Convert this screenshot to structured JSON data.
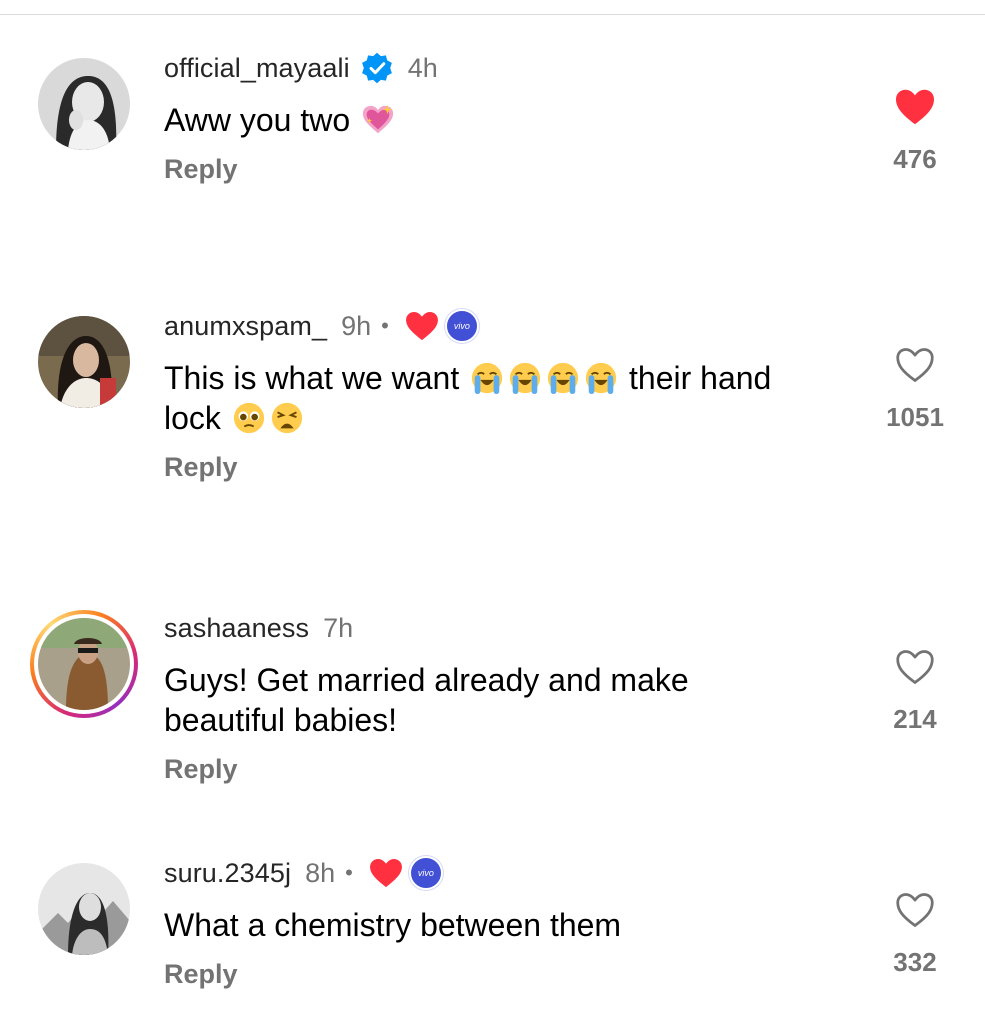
{
  "comments": [
    {
      "username": "official_mayaali",
      "verified": true,
      "time": "4h",
      "text": "Aww you two",
      "text_emojis": [
        "sparkling-heart"
      ],
      "reply_label": "Reply",
      "likes": "476",
      "liked": true
    },
    {
      "username": "anumxspam_",
      "time": "9h",
      "dot": "•",
      "creator_liked": true,
      "badge": "vivo",
      "text_part1": "This is what we want",
      "text_emojis_1": [
        "loudly-crying-face",
        "loudly-crying-face",
        "loudly-crying-face",
        "loudly-crying-face"
      ],
      "text_part2": "their hand",
      "text_part3": "lock",
      "text_emojis_2": [
        "pleading-face",
        "weary-face"
      ],
      "reply_label": "Reply",
      "likes": "1051",
      "liked": false
    },
    {
      "username": "sashaaness",
      "time": "7h",
      "story_ring": true,
      "text_line1": "Guys! Get married already and make",
      "text_line2": "beautiful babies!",
      "reply_label": "Reply",
      "likes": "214",
      "liked": false
    },
    {
      "username": "suru.2345j",
      "time": "8h",
      "dot": "•",
      "creator_liked": true,
      "badge": "vivo",
      "text": "What a chemistry between them",
      "reply_label": "Reply",
      "likes": "332",
      "liked": false
    }
  ],
  "colors": {
    "like_red": "#ff3040",
    "verified_blue": "#0095f6",
    "muted_gray": "#737373",
    "vivo_blue": "#4150d4"
  }
}
